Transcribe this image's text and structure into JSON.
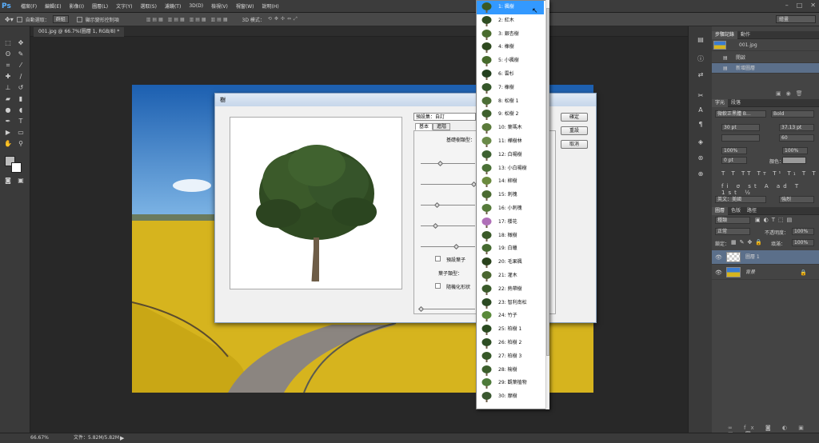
{
  "app": {
    "logo": "Ps"
  },
  "menu": [
    "檔案(F)",
    "編輯(E)",
    "影像(I)",
    "圖層(L)",
    "文字(Y)",
    "選取(S)",
    "濾鏡(T)",
    "3D(D)",
    "檢視(V)",
    "視窗(W)",
    "說明(H)"
  ],
  "options": {
    "auto_select_label": "自動選取：",
    "auto_select_value": "群組",
    "transform_label": "顯示變形控制項",
    "mode_3d_label": "3D 模式：",
    "workspace": "繪畫"
  },
  "document": {
    "tab_title": "001.jpg @ 66.7%(圖層 1, RGB/8) *"
  },
  "status": {
    "zoom": "66.67%",
    "file": "文件：5.82M/5.82M"
  },
  "dialog": {
    "title": "樹",
    "preset_label": "預設集：自訂",
    "tabs": [
      "基本",
      "進階"
    ],
    "base_tree_label": "基礎樹類型：",
    "leaves_checkbox": "預設葉子",
    "leaf_type_label": "葉子類型：",
    "randomize_label": "隨機化形狀",
    "ok": "確定",
    "reset": "重設",
    "cancel": "取消"
  },
  "tree_types": [
    "1: 楓樹",
    "2: 紅木",
    "3: 銀杏樹",
    "4: 橡樹",
    "5: 小楓樹",
    "6: 雲杉",
    "7: 橡樹",
    "8: 松樹 1",
    "9: 松樹 2",
    "10: 葉瑪木",
    "11: 樺樹林",
    "12: 白楊樹",
    "13: 小白楊樹",
    "14: 柳樹",
    "15: 刺槐",
    "16: 小刺槐",
    "17: 櫻花",
    "18: 橄樹",
    "19: 白蠟",
    "20: 毛果楓",
    "21: 灌木",
    "22: 熱帶樹",
    "23: 智利南松",
    "24: 竹子",
    "25: 柏樹 1",
    "26: 柏樹 2",
    "27: 柏樹 3",
    "28: 榆樹",
    "29: 觀葉植物",
    "30: 摩樹"
  ],
  "panels": {
    "history": {
      "tabs": [
        "步驟記錄",
        "動作"
      ],
      "items": [
        "001.jpg",
        "開啟",
        "新增圖層"
      ]
    },
    "character": {
      "tabs": [
        "字元",
        "段落"
      ],
      "font": "微軟正黑體 B...",
      "style": "Bold",
      "size": "30 pt",
      "leading": "37.13 pt",
      "tracking": "60",
      "scale_v": "100%",
      "scale_h": "100%",
      "baseline": "0 pt",
      "color_label": "顏色：",
      "language": "英文：美國",
      "aa": "強烈"
    },
    "layers": {
      "tabs": [
        "圖層",
        "色版",
        "路徑"
      ],
      "kind": "種類",
      "blend": "正常",
      "opacity_label": "不透明度：",
      "opacity": "100%",
      "lock_label": "鎖定：",
      "fill_label": "填滿：",
      "fill": "100%",
      "rows": [
        "圖層 1",
        "背景"
      ]
    }
  },
  "colors": {
    "accent": "#3399ff",
    "dialog_bg": "#f0f0f0"
  }
}
